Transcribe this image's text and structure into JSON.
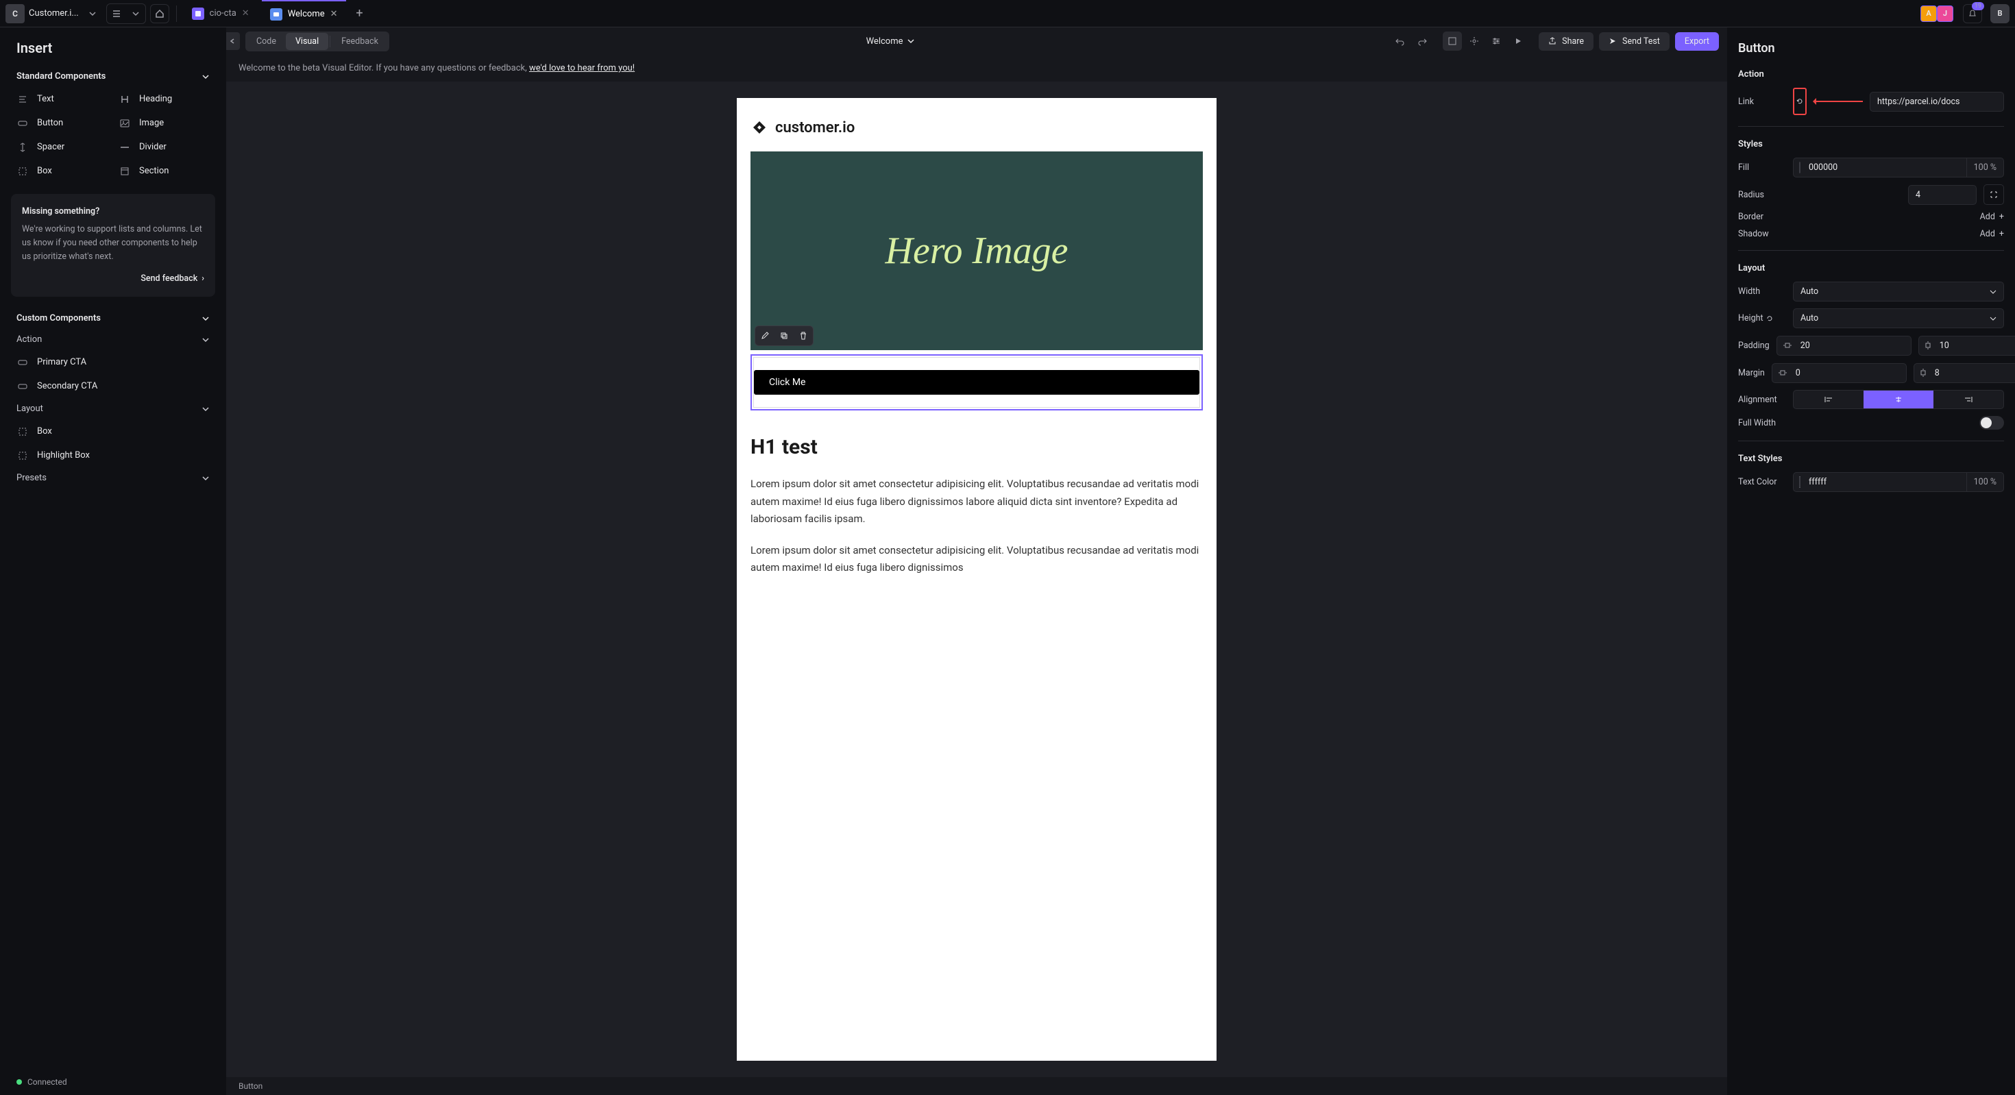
{
  "topbar": {
    "workspace_badge": "C",
    "workspace_name": "Customer.i...",
    "tabs": [
      {
        "label": "cio-cta"
      },
      {
        "label": "Welcome"
      }
    ],
    "avatars": [
      {
        "letter": "A",
        "bg": "#f59e0b"
      },
      {
        "letter": "J",
        "bg": "#ec4899"
      }
    ],
    "notif_count": "19",
    "user_badge": "B"
  },
  "left": {
    "title": "Insert",
    "std_header": "Standard Components",
    "components": [
      {
        "label": "Text"
      },
      {
        "label": "Heading"
      },
      {
        "label": "Button"
      },
      {
        "label": "Image"
      },
      {
        "label": "Spacer"
      },
      {
        "label": "Divider"
      },
      {
        "label": "Box"
      },
      {
        "label": "Section"
      }
    ],
    "info_title": "Missing something?",
    "info_body": "We're working to support lists and columns. Let us know if you need other components to help us prioritize what's next.",
    "info_cta": "Send feedback",
    "custom_header": "Custom Components",
    "action_header": "Action",
    "action_items": [
      {
        "label": "Primary CTA"
      },
      {
        "label": "Secondary CTA"
      }
    ],
    "layout_header": "Layout",
    "layout_items": [
      {
        "label": "Box"
      },
      {
        "label": "Highlight Box"
      }
    ],
    "presets_header": "Presets",
    "status": "Connected"
  },
  "center": {
    "view_tabs": {
      "code": "Code",
      "visual": "Visual",
      "feedback": "Feedback"
    },
    "doc_title": "Welcome",
    "share": "Share",
    "send_test": "Send Test",
    "export": "Export",
    "banner_pre": "Welcome to the beta Visual Editor. If you have any questions or feedback, ",
    "banner_link": "we'd love to hear from you!",
    "logo_text": "customer.io",
    "hero_text": "Hero Image",
    "cta_label": "Click Me",
    "h1": "H1 test",
    "para1": "Lorem ipsum dolor sit amet consectetur adipisicing elit. Voluptatibus recusandae ad veritatis modi autem maxime! Id eius fuga libero dignissimos labore aliquid dicta sint inventore? Expedita ad laboriosam facilis ipsam.",
    "para2": "Lorem ipsum dolor sit amet consectetur adipisicing elit. Voluptatibus recusandae ad veritatis modi autem maxime! Id eius fuga libero dignissimos",
    "crumb": "Button"
  },
  "right": {
    "title": "Button",
    "action_label": "Action",
    "link_label": "Link",
    "link_value": "https://parcel.io/docs",
    "styles_label": "Styles",
    "fill_label": "Fill",
    "fill_value": "000000",
    "fill_pct": "100 %",
    "radius_label": "Radius",
    "radius_value": "4",
    "border_label": "Border",
    "shadow_label": "Shadow",
    "add_label": "Add",
    "layout_label": "Layout",
    "width_label": "Width",
    "width_value": "Auto",
    "height_label": "Height",
    "height_value": "Auto",
    "padding_label": "Padding",
    "padding_h": "20",
    "padding_v": "10",
    "margin_label": "Margin",
    "margin_h": "0",
    "margin_v": "8",
    "alignment_label": "Alignment",
    "fullwidth_label": "Full Width",
    "textstyles_label": "Text Styles",
    "textcolor_label": "Text Color",
    "textcolor_value": "ffffff",
    "textcolor_pct": "100 %"
  }
}
